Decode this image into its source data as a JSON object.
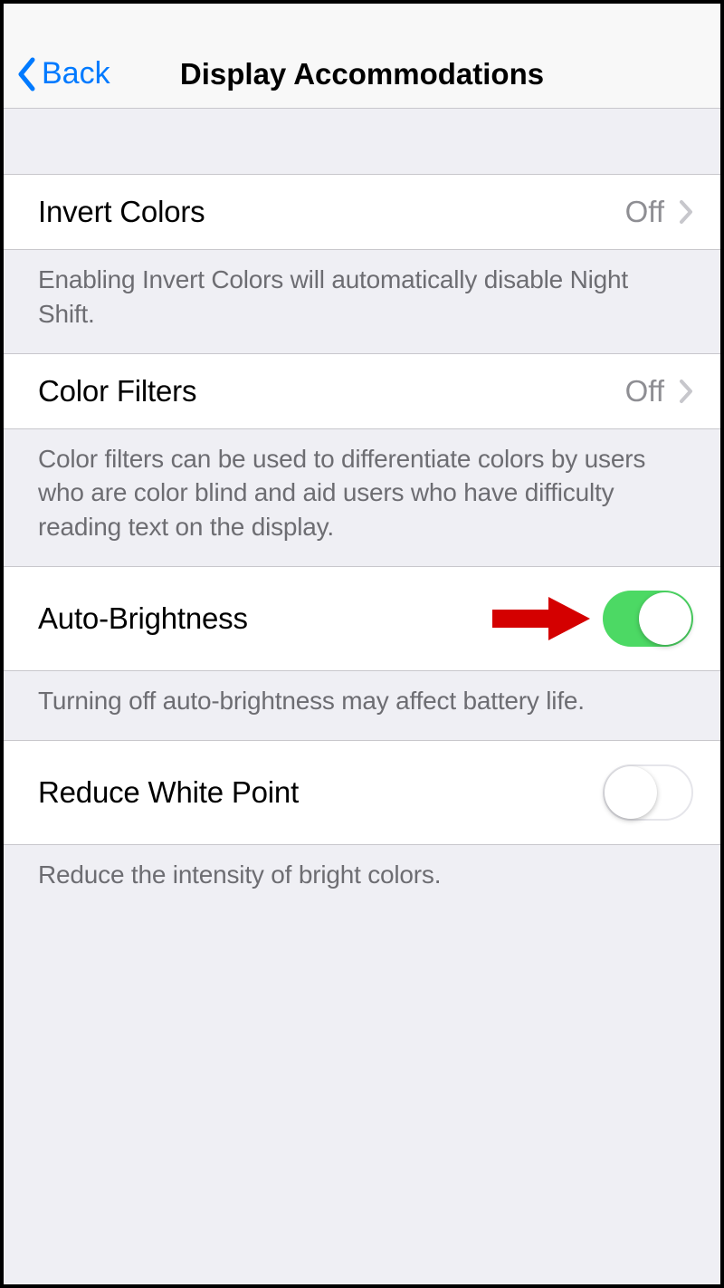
{
  "nav": {
    "back_label": "Back",
    "title": "Display Accommodations"
  },
  "rows": {
    "invert_colors": {
      "label": "Invert Colors",
      "value": "Off",
      "footer": "Enabling Invert Colors will automatically disable Night Shift."
    },
    "color_filters": {
      "label": "Color Filters",
      "value": "Off",
      "footer": "Color filters can be used to differentiate colors by users who are color blind and aid users who have difficulty reading text on the display."
    },
    "auto_brightness": {
      "label": "Auto-Brightness",
      "enabled": true,
      "footer": "Turning off auto-brightness may affect battery life."
    },
    "reduce_white_point": {
      "label": "Reduce White Point",
      "enabled": false,
      "footer": "Reduce the intensity of bright colors."
    }
  },
  "colors": {
    "tint": "#007aff",
    "toggle_on": "#4cd964",
    "annotation_arrow": "#d40000"
  }
}
